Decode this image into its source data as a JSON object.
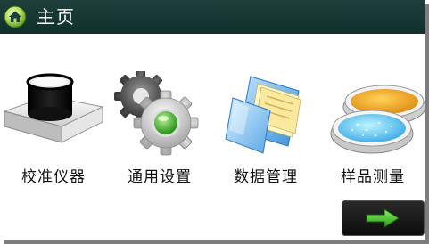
{
  "header": {
    "title": "主页",
    "icon": "home-icon"
  },
  "tiles": [
    {
      "label": "校准仪器",
      "icon": "calibration-icon"
    },
    {
      "label": "通用设置",
      "icon": "gear-icon"
    },
    {
      "label": "数据管理",
      "icon": "folder-icon"
    },
    {
      "label": "样品测量",
      "icon": "sample-dish-icon"
    }
  ],
  "footer": {
    "next_icon": "arrow-right-icon"
  },
  "colors": {
    "titlebar": "#1a3a37",
    "accent_green": "#3cb43c"
  }
}
